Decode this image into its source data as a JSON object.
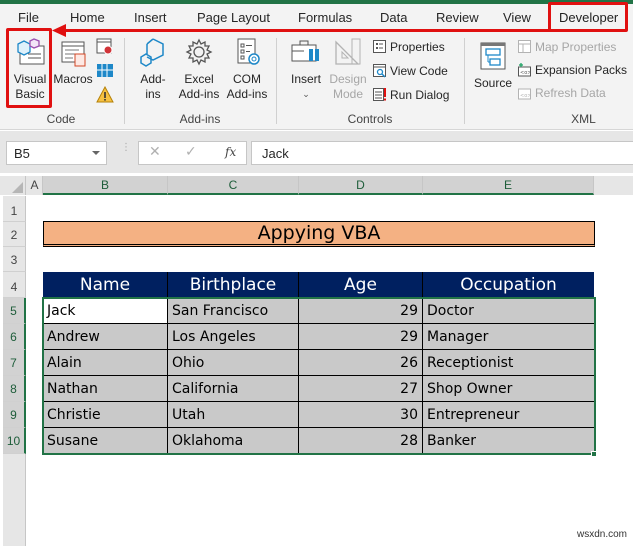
{
  "ribbon_tabs": [
    "File",
    "Home",
    "Insert",
    "Page Layout",
    "Formulas",
    "Data",
    "Review",
    "View",
    "Developer"
  ],
  "active_tab": "Developer",
  "ribbon": {
    "code": {
      "label": "Code",
      "visual_basic": [
        "Visual",
        "Basic"
      ],
      "macros": "Macros"
    },
    "addins": {
      "label": "Add-ins",
      "addins": [
        "Add-",
        "ins"
      ],
      "excel_addins": [
        "Excel",
        "Add-ins"
      ],
      "com_addins": [
        "COM",
        "Add-ins"
      ]
    },
    "controls": {
      "label": "Controls",
      "insert": "Insert",
      "design_mode": [
        "Design",
        "Mode"
      ],
      "properties": "Properties",
      "view_code": "View Code",
      "run_dialog": "Run Dialog"
    },
    "xml": {
      "label": "XML",
      "source": "Source",
      "map_properties": "Map Properties",
      "expansion_packs": "Expansion Packs",
      "refresh_data": "Refresh Data"
    }
  },
  "formula_bar": {
    "name_box": "B5",
    "cancel": "✕",
    "enter": "✓",
    "fx": "fx",
    "value": "Jack"
  },
  "columns": [
    "A",
    "B",
    "C",
    "D",
    "E"
  ],
  "rows": [
    "1",
    "2",
    "3",
    "4",
    "5",
    "6",
    "7",
    "8",
    "9",
    "10"
  ],
  "sheet": {
    "title": "Appying VBA",
    "headers": [
      "Name",
      "Birthplace",
      "Age",
      "Occupation"
    ],
    "records": [
      {
        "name": "Jack",
        "birthplace": "San Francisco",
        "age": "29",
        "occupation": "Doctor"
      },
      {
        "name": "Andrew",
        "birthplace": "Los Angeles",
        "age": "29",
        "occupation": "Manager"
      },
      {
        "name": "Alain",
        "birthplace": "Ohio",
        "age": "26",
        "occupation": "Receptionist"
      },
      {
        "name": "Nathan",
        "birthplace": "California",
        "age": "27",
        "occupation": "Shop Owner"
      },
      {
        "name": "Christie",
        "birthplace": "Utah",
        "age": "30",
        "occupation": "Entrepreneur"
      },
      {
        "name": "Susane",
        "birthplace": "Oklahoma",
        "age": "28",
        "occupation": "Banker"
      }
    ]
  },
  "colors": {
    "excel_green": "#217346",
    "header_fill": "#002060",
    "title_fill": "#f4b183",
    "cell_fill": "#c9c9c9",
    "annotation_red": "#e01010"
  },
  "watermark": "wsxdn.com"
}
